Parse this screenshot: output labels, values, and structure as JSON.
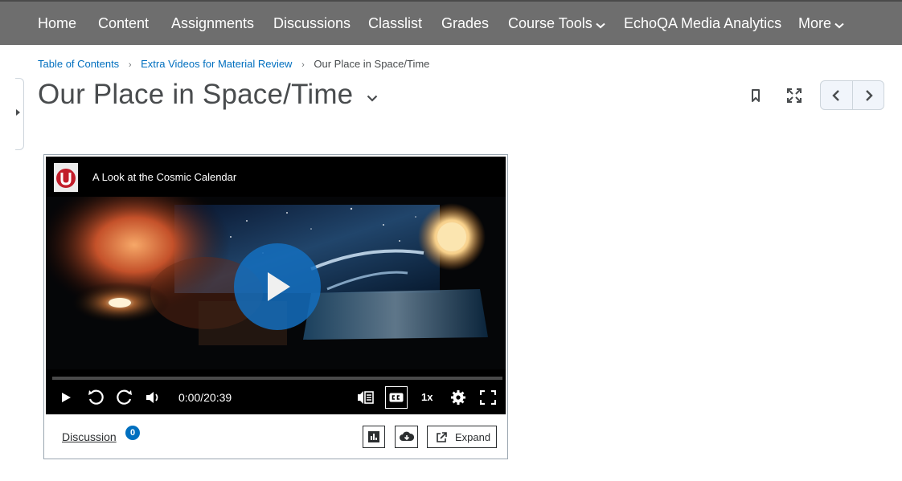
{
  "nav": {
    "items": [
      {
        "label": "Home"
      },
      {
        "label": "Content"
      },
      {
        "label": "Assignments"
      },
      {
        "label": "Discussions"
      },
      {
        "label": "Classlist"
      },
      {
        "label": "Grades"
      },
      {
        "label": "Course Tools"
      },
      {
        "label": "EchoQA Media Analytics"
      },
      {
        "label": "More"
      }
    ]
  },
  "breadcrumb": {
    "root": "Table of Contents",
    "parent": "Extra Videos for Material Review",
    "current": "Our Place in Space/Time"
  },
  "page": {
    "title": "Our Place in Space/Time"
  },
  "video": {
    "title": "A Look at the Cosmic Calendar",
    "time": "0:00/20:39",
    "speed": "1x"
  },
  "footer": {
    "discussion_label": "Discussion",
    "discussion_count": "0",
    "expand_label": "Expand"
  },
  "colors": {
    "nav_bg": "#6e6e6e",
    "link": "#006fbf",
    "play_button": "#146ebe"
  }
}
